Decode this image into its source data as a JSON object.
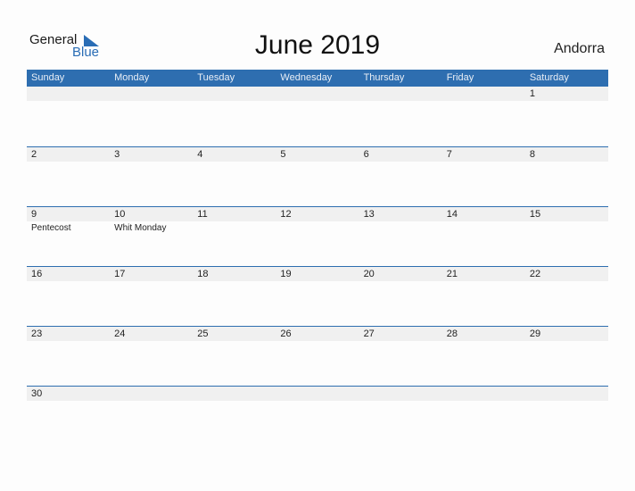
{
  "logo": {
    "general": "General",
    "blue": "Blue"
  },
  "title": "June 2019",
  "country": "Andorra",
  "weekdays": [
    "Sunday",
    "Monday",
    "Tuesday",
    "Wednesday",
    "Thursday",
    "Friday",
    "Saturday"
  ],
  "weeks": [
    [
      {
        "d": ""
      },
      {
        "d": ""
      },
      {
        "d": ""
      },
      {
        "d": ""
      },
      {
        "d": ""
      },
      {
        "d": ""
      },
      {
        "d": "1"
      }
    ],
    [
      {
        "d": "2"
      },
      {
        "d": "3"
      },
      {
        "d": "4"
      },
      {
        "d": "5"
      },
      {
        "d": "6"
      },
      {
        "d": "7"
      },
      {
        "d": "8"
      }
    ],
    [
      {
        "d": "9",
        "e": "Pentecost"
      },
      {
        "d": "10",
        "e": "Whit Monday"
      },
      {
        "d": "11"
      },
      {
        "d": "12"
      },
      {
        "d": "13"
      },
      {
        "d": "14"
      },
      {
        "d": "15"
      }
    ],
    [
      {
        "d": "16"
      },
      {
        "d": "17"
      },
      {
        "d": "18"
      },
      {
        "d": "19"
      },
      {
        "d": "20"
      },
      {
        "d": "21"
      },
      {
        "d": "22"
      }
    ],
    [
      {
        "d": "23"
      },
      {
        "d": "24"
      },
      {
        "d": "25"
      },
      {
        "d": "26"
      },
      {
        "d": "27"
      },
      {
        "d": "28"
      },
      {
        "d": "29"
      }
    ],
    [
      {
        "d": "30"
      },
      {
        "d": ""
      },
      {
        "d": ""
      },
      {
        "d": ""
      },
      {
        "d": ""
      },
      {
        "d": ""
      },
      {
        "d": ""
      }
    ]
  ]
}
